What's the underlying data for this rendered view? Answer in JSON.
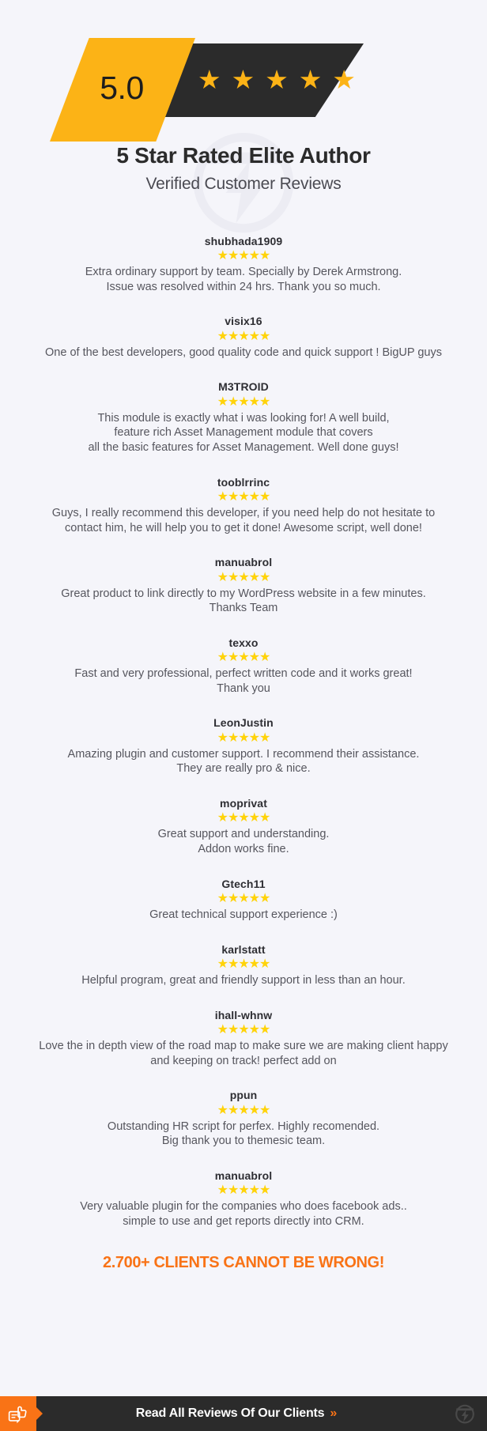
{
  "badge": {
    "score": "5.0",
    "stars": [
      "★",
      "★",
      "★",
      "★",
      "★"
    ],
    "star_count": 5,
    "dark_color": "#2b2b2b",
    "score_color": "#fcb316",
    "fold_color": "#f26a21"
  },
  "header": {
    "title": "5 Star Rated Elite Author",
    "subtitle": "Verified Customer Reviews"
  },
  "reviews": [
    {
      "author": "shubhada1909",
      "stars": "★★★★★",
      "text": "Extra ordinary support by team. Specially by Derek Armstrong.\nIssue was resolved within 24 hrs. Thank you so much."
    },
    {
      "author": "visix16",
      "stars": "★★★★★",
      "text": "One of the best developers, good quality code and quick support ! BigUP guys"
    },
    {
      "author": "M3TROID",
      "stars": "★★★★★",
      "text": "This module is exactly what i was looking for! A well build,\nfeature rich Asset Management module that covers\nall the basic features for Asset Management. Well done guys!"
    },
    {
      "author": "tooblrrinc",
      "stars": "★★★★★",
      "text": "Guys, I really recommend this developer, if you need help do not hesitate to\ncontact him, he will help you to get it done! Awesome script, well done!"
    },
    {
      "author": "manuabrol",
      "stars": "★★★★★",
      "text": "Great product to link directly to my WordPress website in a few minutes.\nThanks Team"
    },
    {
      "author": "texxo",
      "stars": "★★★★★",
      "text": "Fast and very professional, perfect written code and it works great!\nThank you"
    },
    {
      "author": "LeonJustin",
      "stars": "★★★★★",
      "text": "Amazing plugin and customer support. I recommend their assistance.\nThey are really pro & nice."
    },
    {
      "author": "moprivat",
      "stars": "★★★★★",
      "text": "Great support and understanding.\nAddon works fine."
    },
    {
      "author": "Gtech11",
      "stars": "★★★★★",
      "text": "Great technical support experience :)"
    },
    {
      "author": "karlstatt",
      "stars": "★★★★★",
      "text": "Helpful program, great and friendly support in less than an hour."
    },
    {
      "author": "ihall-whnw",
      "stars": "★★★★★",
      "text": "Love the in depth view of the road map to make sure we are making client happy\nand keeping on track! perfect add on"
    },
    {
      "author": "ppun",
      "stars": "★★★★★",
      "text": "Outstanding HR script for perfex. Highly recomended.\nBig thank you to themesic team."
    },
    {
      "author": "manuabrol",
      "stars": "★★★★★",
      "text": "Very valuable plugin for the companies who does facebook ads..\nsimple to use and get reports directly into CRM."
    }
  ],
  "cta": {
    "headline": "2.700+ CLIENTS CANNOT BE WRONG!",
    "headline_color": "#f97316"
  },
  "footer": {
    "icon": "review-thumbsup-icon",
    "label": "Read All Reviews Of Our Clients",
    "arrows": "»",
    "logo": "themesic-bolt-logo",
    "bar_color": "#2b2b2b",
    "accent_color": "#f97316"
  }
}
